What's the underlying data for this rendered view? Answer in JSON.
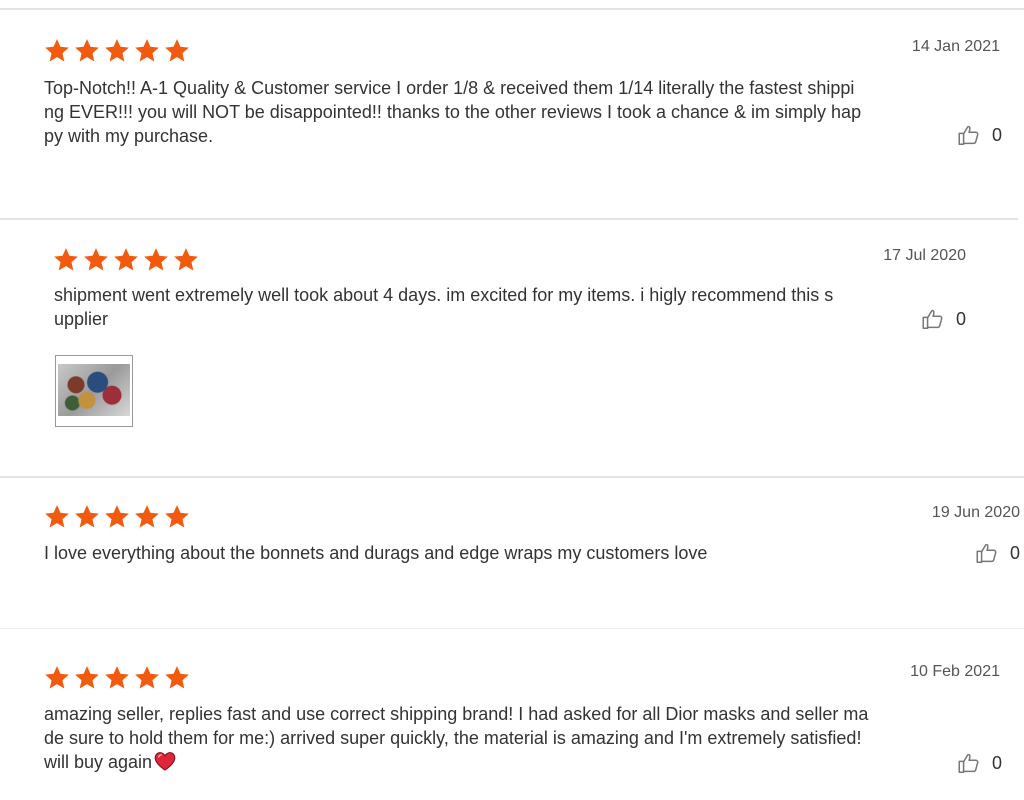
{
  "colors": {
    "star": "#f25a0f",
    "text": "#333333",
    "date": "#555555",
    "separator": "#e3e3e3"
  },
  "icons": {
    "star": "star-icon",
    "like": "thumbs-up-icon",
    "heart": "heart-emoji-icon"
  },
  "reviews": [
    {
      "rating": 5,
      "date": "14 Jan 2021",
      "text": "Top-Notch!! A-1 Quality & Customer service I order 1/8 & received them 1/14 literally the fastest shipping EVER!!! you will NOT be disappointed!! thanks to the other reviews I took a chance & im simply happy with my purchase.",
      "likes": "0"
    },
    {
      "rating": 5,
      "date": "17 Jul 2020",
      "text": "shipment went extremely well took about 4 days. im excited for my items. i higly recommend this supplier",
      "likes": "0",
      "has_photo": true
    },
    {
      "rating": 5,
      "date": "19 Jun 2020",
      "text": "I love everything about the bonnets and durags and edge wraps my customers love",
      "likes": "0"
    },
    {
      "rating": 5,
      "date": "10 Feb 2021",
      "text": "amazing seller, replies fast and use correct shipping brand! I had asked for all Dior masks and seller made sure to hold them for me:) arrived super quickly, the material is amazing and I'm extremely satisfied! will buy again",
      "likes": "0",
      "trailing_emoji": "heart"
    }
  ]
}
